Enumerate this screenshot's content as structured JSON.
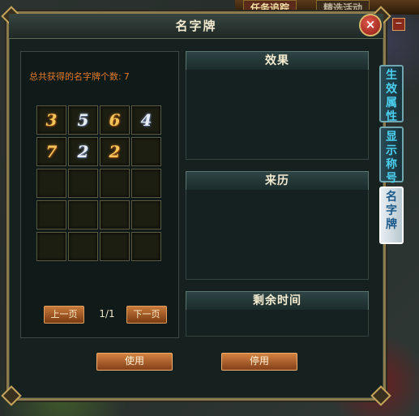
{
  "top_tabs": [
    {
      "label": "任务追踪"
    },
    {
      "label": "精选活动"
    }
  ],
  "window": {
    "title": "名字牌",
    "close_label": "×"
  },
  "left_panel": {
    "count_label": "总共获得的名字牌个数:",
    "count_value": "7",
    "slots": [
      {
        "glyph": "3",
        "style": "gold"
      },
      {
        "glyph": "5",
        "style": "silver"
      },
      {
        "glyph": "6",
        "style": "gold"
      },
      {
        "glyph": "4",
        "style": "silver"
      },
      {
        "glyph": "7",
        "style": "gold"
      },
      {
        "glyph": "2",
        "style": "silver"
      },
      {
        "glyph": "2",
        "style": "gold"
      },
      {
        "glyph": "",
        "style": ""
      },
      {
        "glyph": "",
        "style": ""
      },
      {
        "glyph": "",
        "style": ""
      },
      {
        "glyph": "",
        "style": ""
      },
      {
        "glyph": "",
        "style": ""
      },
      {
        "glyph": "",
        "style": ""
      },
      {
        "glyph": "",
        "style": ""
      },
      {
        "glyph": "",
        "style": ""
      },
      {
        "glyph": "",
        "style": ""
      },
      {
        "glyph": "",
        "style": ""
      },
      {
        "glyph": "",
        "style": ""
      },
      {
        "glyph": "",
        "style": ""
      },
      {
        "glyph": "",
        "style": ""
      }
    ],
    "pager": {
      "prev_label": "上一页",
      "page_text": "1/1",
      "next_label": "下一页"
    }
  },
  "right_panel": {
    "effect_title": "效果",
    "origin_title": "来历",
    "remaining_title": "剩余时间"
  },
  "actions": {
    "use_label": "使用",
    "stop_label": "停用"
  },
  "side_tabs": [
    {
      "label": "生效属性",
      "active": false
    },
    {
      "label": "显示称号",
      "active": false
    },
    {
      "label": "名字牌",
      "active": true
    }
  ],
  "side_minus": "−",
  "colors": {
    "accent_orange": "#e07a2a",
    "tab_cyan": "#4ad0f0",
    "frame_gold": "#8a7a4e"
  }
}
